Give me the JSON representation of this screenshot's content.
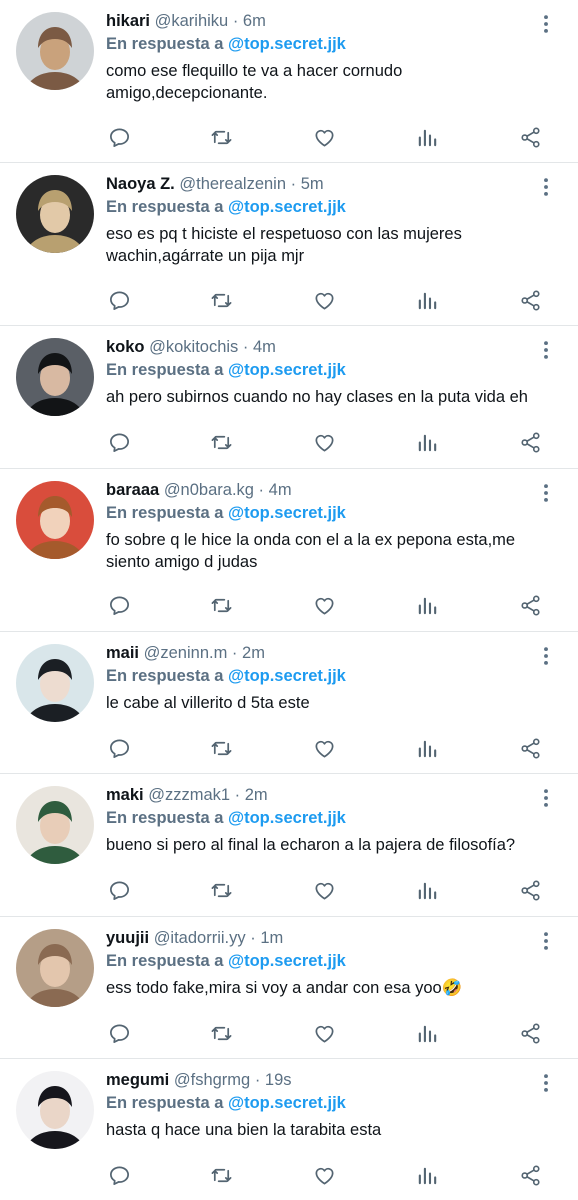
{
  "reply_prefix": "En respuesta a",
  "reply_target": "@top.secret.jjk",
  "colors": {
    "link": "#1d9bf0",
    "muted": "#5b7083",
    "text": "#0f1419",
    "divider": "#e3e6e8"
  },
  "icons": [
    "more-vertical-icon",
    "reply-icon",
    "retweet-icon",
    "like-icon",
    "stats-icon",
    "share-icon"
  ],
  "tweets": [
    {
      "name": "hikari",
      "handle": "@karihiku",
      "dot": "·",
      "time": "6m",
      "text": "como ese flequillo te va a hacer cornudo amigo,decepcionante.",
      "avatar_colors": [
        "#cfd3d6",
        "#7b5a44",
        "#c9a27c"
      ]
    },
    {
      "name": "Naoya Z.",
      "handle": "@therealzenin",
      "dot": "·",
      "time": "5m",
      "text": "eso es pq t hiciste el respetuoso con las mujeres wachin,agárrate un pija mjr",
      "avatar_colors": [
        "#2a2a2a",
        "#b8a070",
        "#e2c9a8"
      ]
    },
    {
      "name": "koko",
      "handle": "@kokitochis",
      "dot": "·",
      "time": "4m",
      "text": "ah pero subirnos cuando no hay clases en la puta vida eh",
      "avatar_colors": [
        "#5a5f66",
        "#121416",
        "#d8b9a2"
      ]
    },
    {
      "name": "baraaa",
      "handle": "@n0bara.kg",
      "dot": "·",
      "time": "4m",
      "text": "fo sobre q le hice la onda con el a la ex pepona esta,me siento amigo d judas",
      "avatar_colors": [
        "#d94d3c",
        "#a55a2c",
        "#f1d2bb"
      ]
    },
    {
      "name": "maii",
      "handle": "@zeninn.m",
      "dot": "·",
      "time": "2m",
      "text": "le cabe al villerito d 5ta este",
      "avatar_colors": [
        "#d9e6ea",
        "#1b1f24",
        "#eddcd0"
      ]
    },
    {
      "name": "maki",
      "handle": "@zzzmak1",
      "dot": "·",
      "time": "2m",
      "text": "bueno si pero al final la echaron a la pajera de filosofía?",
      "avatar_colors": [
        "#e9e5de",
        "#2f5c3e",
        "#e8cdb8"
      ]
    },
    {
      "name": "yuujii",
      "handle": "@itadorrii.yy",
      "dot": "·",
      "time": "1m",
      "text": "ess todo fake,mira si voy a andar con esa yoo🤣",
      "avatar_colors": [
        "#b59e87",
        "#8a6a52",
        "#e3c6ad"
      ]
    },
    {
      "name": "megumi",
      "handle": "@fshgrmg",
      "dot": "·",
      "time": "19s",
      "text": "hasta q hace una bien la tarabita esta",
      "avatar_colors": [
        "#f2f2f4",
        "#16161c",
        "#ead6c8"
      ]
    }
  ]
}
